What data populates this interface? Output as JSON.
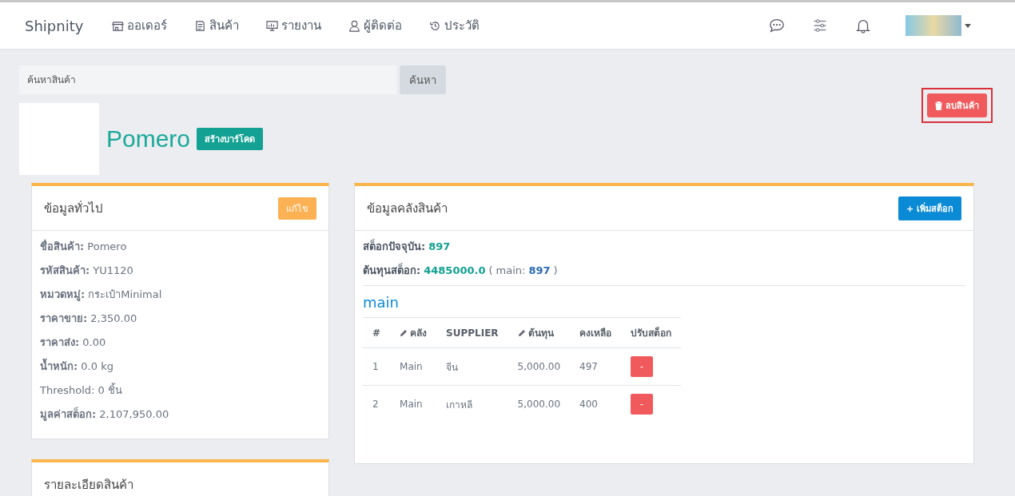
{
  "navbar": {
    "brand": "Shipnity",
    "items": [
      {
        "label": "ออเดอร์"
      },
      {
        "label": "สินค้า"
      },
      {
        "label": "รายงาน"
      },
      {
        "label": "ผู้ติดต่อ"
      },
      {
        "label": "ประวัติ"
      }
    ]
  },
  "search": {
    "placeholder": "ค้นหาสินค้า",
    "button": "ค้นหา"
  },
  "delete_button": "ลบสินค้า",
  "product": {
    "name": "Pomero",
    "barcode_button": "สร้างบาร์โคด"
  },
  "general_card": {
    "title": "ข้อมูลทั่วไป",
    "edit_button": "แก้ไข",
    "fields": [
      "**ชื่อสินค้า:** Pomero",
      "**รหัสสินค้า:** YU1120",
      "**หมวดหมู่:** กระเป๋าMinimal",
      "**ราคาขาย:** 2,350.00",
      "**ราคาส่ง:** 0.00",
      "**น้ำหนัก:** 0.0 kg",
      "Threshold: 0 ชิ้น",
      "**มูลค่าสต็อก:** 2,107,950.00"
    ]
  },
  "detail_card": {
    "title": "รายละเอียดสินค้า"
  },
  "stock_card": {
    "title": "ข้อมูลคลังสินค้า",
    "add_button": "+ เพิ่มสต็อก",
    "current_stock": {
      "label": "สต็อกปัจจุบัน:",
      "value": "897"
    },
    "stock_cost": {
      "label": "ต้นทุนสต็อก:",
      "value": "4485000.0",
      "open": "(",
      "location": "main:",
      "location_value": "897",
      "close": ")"
    },
    "warehouse": "main",
    "columns": [
      {
        "label": "#",
        "editable": false
      },
      {
        "label": "คลัง",
        "editable": true
      },
      {
        "label": "SUPPLIER",
        "editable": false
      },
      {
        "label": "ต้นทุน",
        "editable": true
      },
      {
        "label": "คงเหลือ",
        "editable": false
      },
      {
        "label": "ปรับสต็อก",
        "editable": false
      }
    ],
    "rows": [
      {
        "cells": [
          "1",
          "Main",
          "จีน",
          "5,000.00",
          "497"
        ],
        "action": "-"
      },
      {
        "cells": [
          "2",
          "Main",
          "เกาหลี",
          "5,000.00",
          "400"
        ],
        "action": "-"
      }
    ]
  }
}
